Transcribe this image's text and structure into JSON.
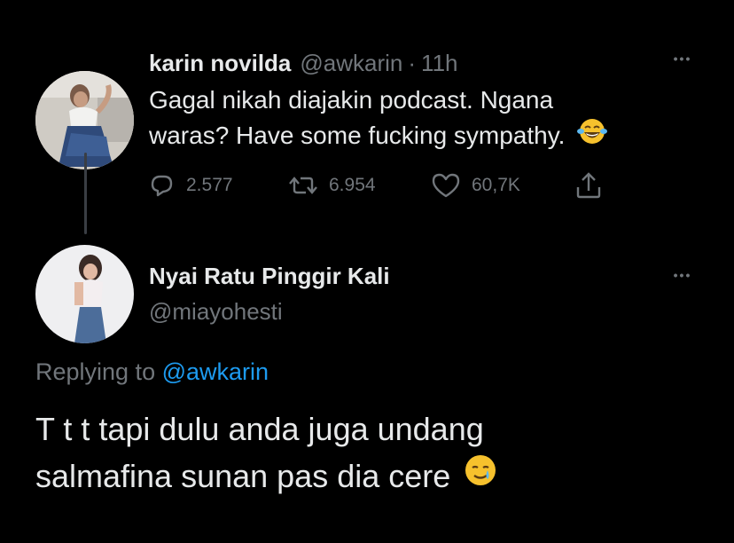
{
  "tweet": {
    "display_name": "karin novilda",
    "handle": "@awkarin",
    "separator": "·",
    "time": "11h",
    "text_line1": "Gagal nikah diajakin podcast. Ngana",
    "text_line2": "waras? Have some fucking sympathy.",
    "emoji": "face-with-tears-of-joy",
    "more_label": "•••",
    "actions": {
      "replies": "2.577",
      "retweets": "6.954",
      "likes": "60,7K"
    }
  },
  "reply": {
    "display_name": "Nyai Ratu Pinggir Kali",
    "handle": "@miayohesti",
    "more_label": "•••",
    "replying_prefix": "Replying to",
    "replying_to": "@awkarin",
    "text_line1": "T t t tapi dulu anda juga undang",
    "text_line2": "salmafina sunan pas dia cere",
    "emoji": "smiling-face-with-tear"
  },
  "colors": {
    "background": "#000000",
    "text": "#e7e9ea",
    "muted": "#71767b",
    "link": "#1d9bf0"
  }
}
